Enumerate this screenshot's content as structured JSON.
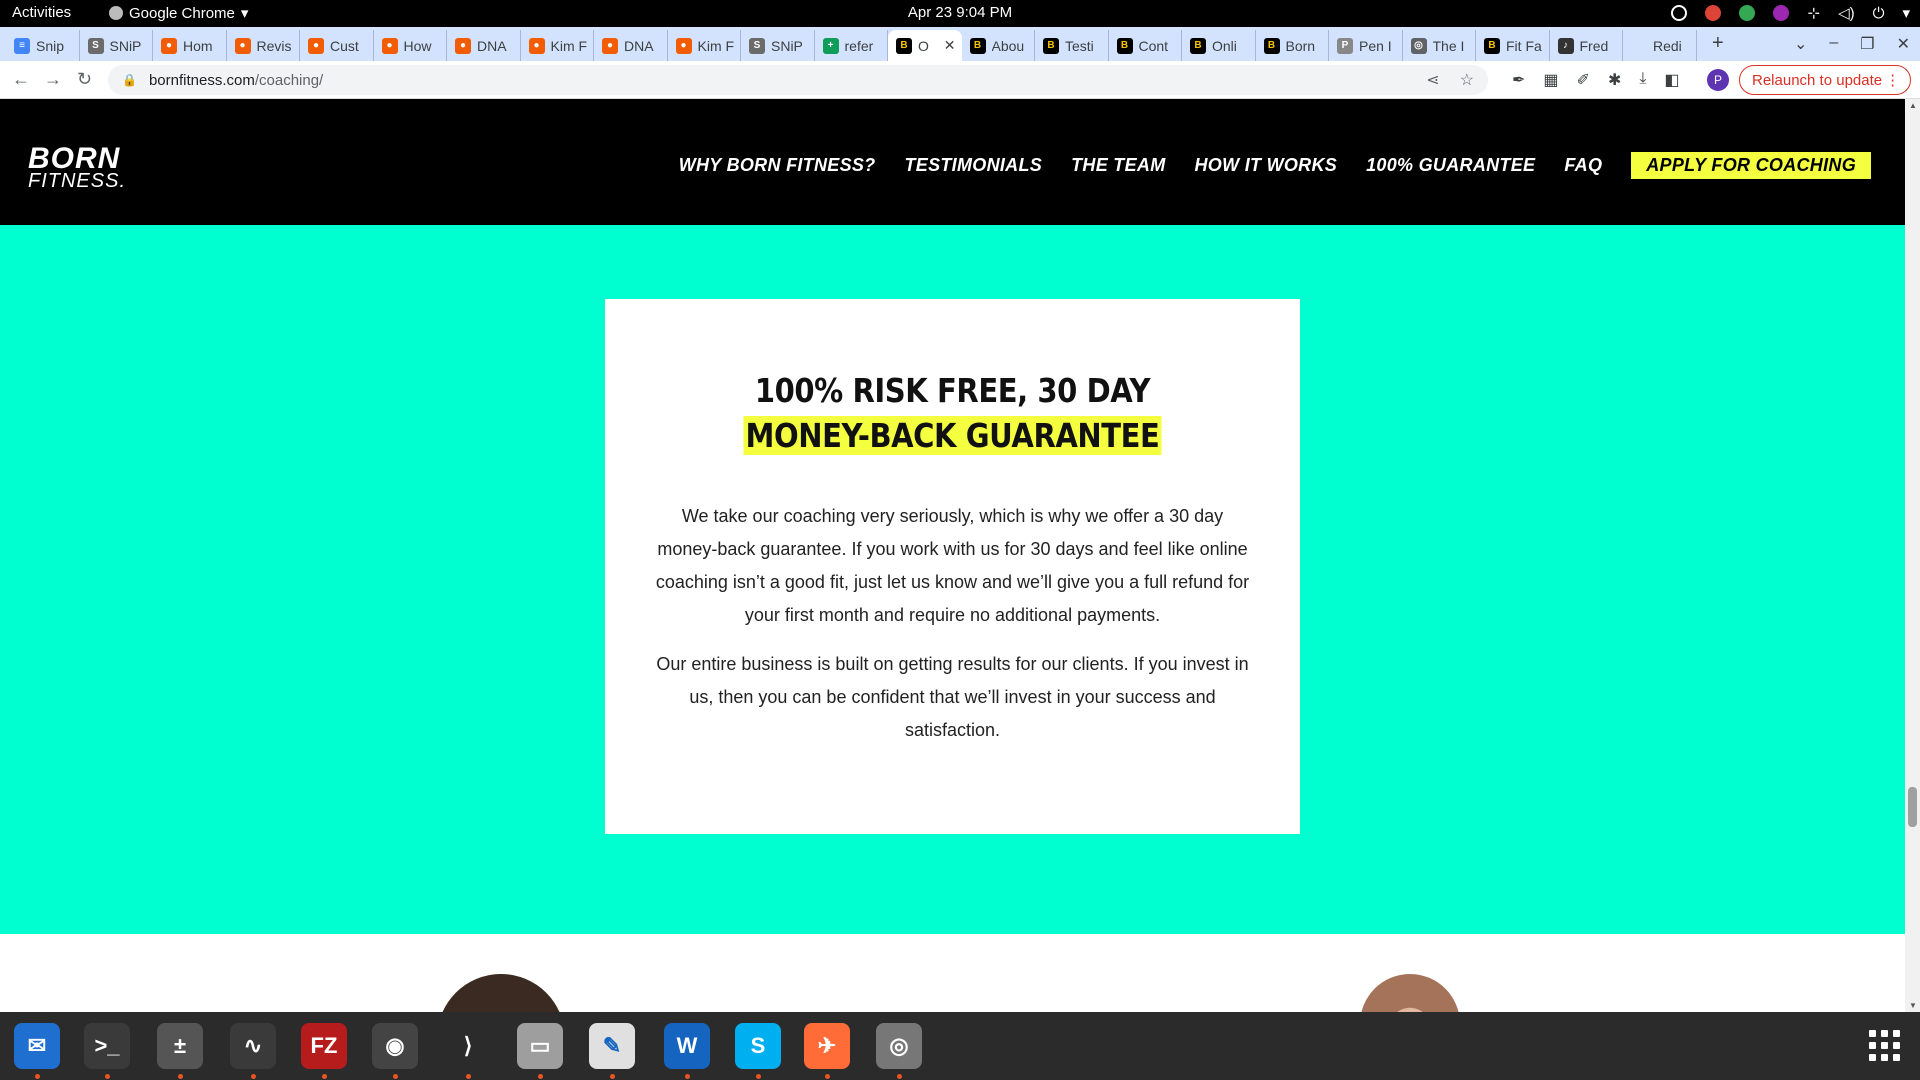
{
  "system": {
    "activities": "Activities",
    "app_name": "Google Chrome",
    "clock": "Apr 23  9:04 PM"
  },
  "tabs": [
    {
      "title": "Snip",
      "fav_color": "#4285f4",
      "fav_glyph": "≡"
    },
    {
      "title": "SNiP",
      "fav_color": "#6b6b6b",
      "fav_glyph": "S"
    },
    {
      "title": "Hom",
      "fav_color": "#f25c05",
      "fav_glyph": "●"
    },
    {
      "title": "Revis",
      "fav_color": "#f25c05",
      "fav_glyph": "●"
    },
    {
      "title": "Cust",
      "fav_color": "#f25c05",
      "fav_glyph": "●"
    },
    {
      "title": "How",
      "fav_color": "#f25c05",
      "fav_glyph": "●"
    },
    {
      "title": "DNA",
      "fav_color": "#f25c05",
      "fav_glyph": "●"
    },
    {
      "title": "Kim F",
      "fav_color": "#f25c05",
      "fav_glyph": "●"
    },
    {
      "title": "DNA",
      "fav_color": "#f25c05",
      "fav_glyph": "●"
    },
    {
      "title": "Kim F",
      "fav_color": "#f25c05",
      "fav_glyph": "●"
    },
    {
      "title": "SNiP",
      "fav_color": "#6b6b6b",
      "fav_glyph": "S"
    },
    {
      "title": "refer",
      "fav_color": "#0f9d58",
      "fav_glyph": "+"
    },
    {
      "title": "O",
      "fav_color": "#000000",
      "fav_glyph": "B",
      "active": true
    },
    {
      "title": "Abou",
      "fav_color": "#000000",
      "fav_glyph": "B"
    },
    {
      "title": "Testi",
      "fav_color": "#000000",
      "fav_glyph": "B"
    },
    {
      "title": "Cont",
      "fav_color": "#000000",
      "fav_glyph": "B"
    },
    {
      "title": "Onli",
      "fav_color": "#000000",
      "fav_glyph": "B"
    },
    {
      "title": "Born",
      "fav_color": "#000000",
      "fav_glyph": "B"
    },
    {
      "title": "Pen I",
      "fav_color": "#888888",
      "fav_glyph": "P"
    },
    {
      "title": "The I",
      "fav_color": "#5f6368",
      "fav_glyph": "◎"
    },
    {
      "title": "Fit Fa",
      "fav_color": "#000000",
      "fav_glyph": "B"
    },
    {
      "title": "Fred",
      "fav_color": "#333333",
      "fav_glyph": "♪"
    },
    {
      "title": "Redi",
      "fav_color": "#d3e3fd",
      "fav_glyph": ""
    }
  ],
  "browser": {
    "url_domain": "bornfitness.com",
    "url_path": "/coaching/",
    "profile_initial": "P",
    "relaunch_label": "Relaunch to update"
  },
  "site": {
    "logo_line1": "BORN",
    "logo_line2": "FITNESS.",
    "nav": [
      "WHY BORN FITNESS?",
      "TESTIMONIALS",
      "THE TEAM",
      "HOW IT WORKS",
      "100% GUARANTEE",
      "FAQ"
    ],
    "cta": "APPLY FOR COACHING",
    "accent_color": "#00ffd0",
    "highlight_color": "#f3ff3f"
  },
  "guarantee": {
    "title_line1": "100% RISK FREE, 30 DAY",
    "title_line2": "MONEY-BACK GUARANTEE",
    "paragraph1": "We take our coaching very seriously, which is why we offer a 30 day money-back guarantee. If you work with us for 30 days and feel like online coaching isn’t a good fit, just let us know and we’ll give you a full refund for your first month and require no additional payments.",
    "paragraph2": "Our entire business is built on getting results for our clients. If you invest in us, then you can be confident that we’ll invest in your success and satisfaction."
  },
  "dock": [
    {
      "name": "thunderbird",
      "color": "#1f6fd1",
      "glyph": "✉"
    },
    {
      "name": "terminal",
      "color": "#3a3a3a",
      "glyph": ">_"
    },
    {
      "name": "calculator",
      "color": "#555555",
      "glyph": "±"
    },
    {
      "name": "system-monitor",
      "color": "#3a3a3a",
      "glyph": "∿"
    },
    {
      "name": "filezilla",
      "color": "#b71c1c",
      "glyph": "FZ"
    },
    {
      "name": "chrome",
      "color": "#444444",
      "glyph": "◉"
    },
    {
      "name": "vscode",
      "color": "#2b2b2b",
      "glyph": "⟩"
    },
    {
      "name": "files",
      "color": "#9e9e9e",
      "glyph": "▭"
    },
    {
      "name": "text-editor",
      "color": "#e0e0e0",
      "glyph": "✎"
    },
    {
      "name": "libreoffice-writer",
      "color": "#1565c0",
      "glyph": "W"
    },
    {
      "name": "skype",
      "color": "#00aff0",
      "glyph": "S"
    },
    {
      "name": "postman",
      "color": "#ff6c37",
      "glyph": "✈"
    },
    {
      "name": "disks",
      "color": "#777777",
      "glyph": "◎"
    }
  ]
}
